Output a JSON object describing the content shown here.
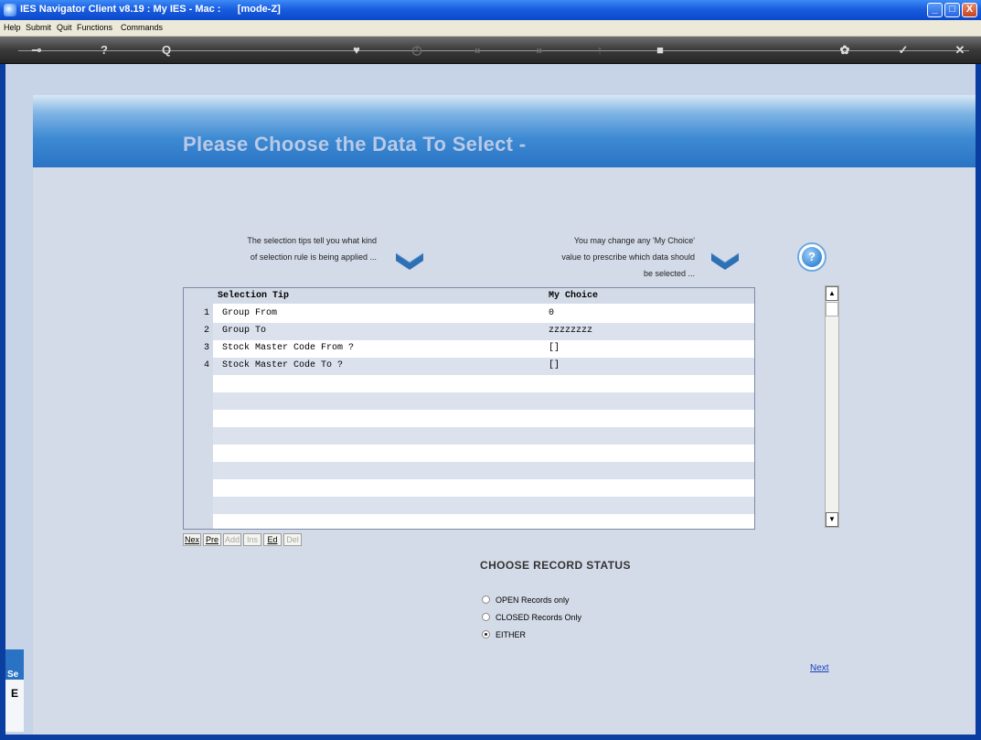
{
  "window": {
    "title": "IES Navigator Client v8.19 : My IES - Mac :      [mode-Z]",
    "min_label": "_",
    "max_label": "□",
    "close_label": "X"
  },
  "menu": {
    "items": [
      "Help",
      "Submit",
      "Quit",
      "Functions",
      "Commands"
    ]
  },
  "toolbar": {
    "icons": [
      "key-icon",
      "help-icon",
      "search-icon",
      "heart-icon",
      "clock-icon",
      "back-icon",
      "forward-icon",
      "page-icon",
      "square-icon",
      "settings-icon",
      "check-icon",
      "close-icon"
    ],
    "glyphs": [
      "⊸",
      "?",
      "Q",
      "♥",
      "◷",
      "«",
      "»",
      "↑",
      "■",
      "✿",
      "✓",
      "✕"
    ]
  },
  "page": {
    "title": "Please Choose the Data To Select -",
    "help_glyph": "?",
    "tip_left_line1": "The selection tips tell you what kind",
    "tip_left_line2": "of selection rule is being applied ...",
    "tip_right_line1": "You may change any 'My Choice'",
    "tip_right_line2": "value to prescribe which data should",
    "tip_right_line3": "be selected ..."
  },
  "grid": {
    "headers": [
      "Selection Tip",
      "My Choice"
    ],
    "rows": [
      {
        "num": "1",
        "tip": "Group From",
        "choice": "0"
      },
      {
        "num": "2",
        "tip": "Group To",
        "choice": "zzzzzzzz"
      },
      {
        "num": "3",
        "tip": "Stock Master Code From ?",
        "choice": "[]"
      },
      {
        "num": "4",
        "tip": "Stock Master Code To ?",
        "choice": "[]"
      }
    ],
    "scroll_up": "▲",
    "scroll_down": "▼"
  },
  "nav_buttons": [
    {
      "label": "Nex",
      "enabled": true
    },
    {
      "label": "Pre",
      "enabled": true
    },
    {
      "label": "Add",
      "enabled": false
    },
    {
      "label": "Ins",
      "enabled": false
    },
    {
      "label": "Ed",
      "enabled": true
    },
    {
      "label": "Del",
      "enabled": false
    }
  ],
  "record_status": {
    "title": "CHOOSE RECORD STATUS",
    "options": [
      "OPEN Records only",
      "CLOSED Records Only",
      "EITHER"
    ],
    "selected": "EITHER"
  },
  "next_label": "Next",
  "side_strip_text": "Se",
  "side_strip_text2": "E"
}
